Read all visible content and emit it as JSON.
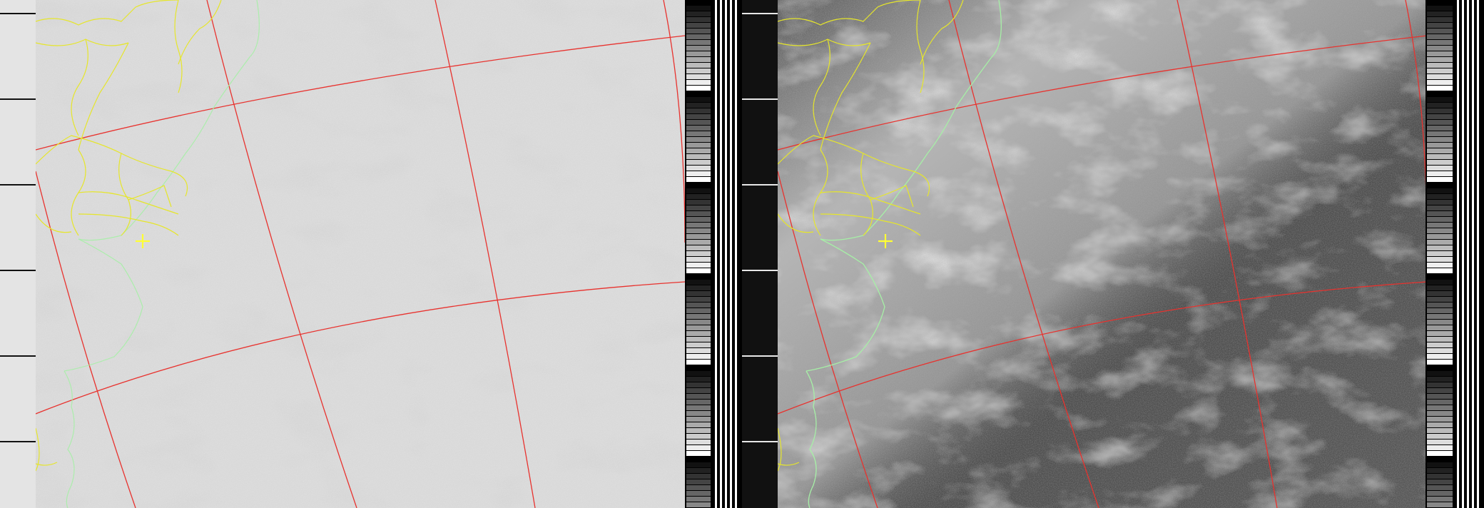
{
  "image": {
    "kind": "APT weather satellite image, dual channel",
    "channels": [
      {
        "id": "A",
        "tone": "light"
      },
      {
        "id": "B",
        "tone": "dark"
      }
    ]
  },
  "colors": {
    "graticule": "#e8322e",
    "political_borders": "#e6e62a",
    "coastline": "#a6f0a6",
    "marker": "#ffff33",
    "sync_bars": "#000000",
    "channel_a_base": "#cfcfcf",
    "channel_b_base": "#5e5e5e"
  },
  "markers": [
    {
      "symbol": "+",
      "name": "station-marker"
    }
  ],
  "layers": [
    "graticule",
    "political-borders",
    "coastline",
    "telemetry-wedges",
    "sync-bars",
    "space-view"
  ]
}
